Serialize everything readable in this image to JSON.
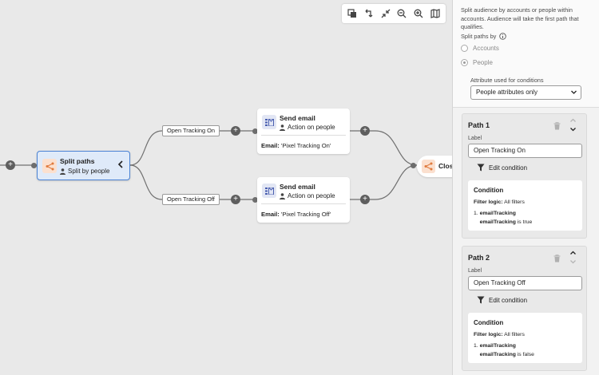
{
  "toolbar": {
    "icons": [
      "copy-icon",
      "undo-icon",
      "collapse-icon",
      "zoom-out-icon",
      "zoom-in-icon",
      "map-icon"
    ]
  },
  "canvas": {
    "split_node": {
      "title": "Split paths",
      "subtitle": "Split by people"
    },
    "paths": [
      {
        "label": "Open Tracking On",
        "email_title": "Send email",
        "email_subtitle": "Action on people",
        "detail_key": "Email:",
        "detail_value": "'Pixel Tracking On'"
      },
      {
        "label": "Open Tracking Off",
        "email_title": "Send email",
        "email_subtitle": "Action on people",
        "detail_key": "Email:",
        "detail_value": "'Pixel Tracking Off'"
      }
    ],
    "close_node": {
      "title": "Close"
    },
    "add_symbol": "+"
  },
  "panel": {
    "description": "Split audience by accounts or people within accounts. Audience will take the first path that qualifies.",
    "split_by_label": "Split paths by",
    "options": [
      {
        "label": "Accounts",
        "selected": false
      },
      {
        "label": "People",
        "selected": true
      }
    ],
    "attribute_label": "Attribute used for conditions",
    "attribute_value": "People attributes only",
    "path_cards": [
      {
        "title": "Path 1",
        "label_caption": "Label",
        "label_value": "Open Tracking On",
        "edit_label": "Edit condition",
        "condition_title": "Condition",
        "filter_key": "Filter logic:",
        "filter_value": "All filters",
        "item_num": "1.",
        "item_bold": "emailTracking",
        "item_attr": "emailTracking",
        "item_value": "is true"
      },
      {
        "title": "Path 2",
        "label_caption": "Label",
        "label_value": "Open Tracking Off",
        "edit_label": "Edit condition",
        "condition_title": "Condition",
        "filter_key": "Filter logic:",
        "filter_value": "All filters",
        "item_num": "1.",
        "item_bold": "emailTracking",
        "item_attr": "emailTracking",
        "item_value": "is false"
      }
    ]
  },
  "colors": {
    "canvas_bg": "#e9e9e9",
    "split_node_bg": "#dfeaf9",
    "split_node_border": "#4a82d4",
    "split_icon": "#e07a3d",
    "email_icon": "#4a5fb0"
  }
}
